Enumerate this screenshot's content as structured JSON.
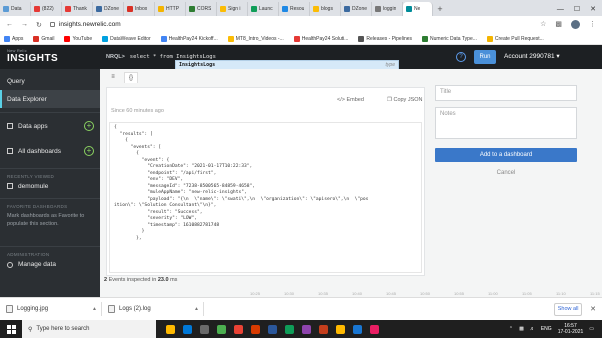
{
  "browser": {
    "tabs": [
      {
        "label": "Data",
        "color": "#5b9bd5"
      },
      {
        "label": "(822)",
        "color": "#e53935"
      },
      {
        "label": "Thank",
        "color": "#e53935"
      },
      {
        "label": "DZone",
        "color": "#3b6aa0"
      },
      {
        "label": "Inbox",
        "color": "#d93025"
      },
      {
        "label": "HTTP",
        "color": "#f4b400"
      },
      {
        "label": "CORS",
        "color": "#2e7d32"
      },
      {
        "label": "Sign i",
        "color": "#fbbc05"
      },
      {
        "label": "Launc",
        "color": "#0f9d58"
      },
      {
        "label": "Resou",
        "color": "#1e88e5"
      },
      {
        "label": "blogs",
        "color": "#fbbc05"
      },
      {
        "label": "DZone",
        "color": "#3b6aa0"
      },
      {
        "label": "loggin",
        "color": "#777777"
      },
      {
        "label": "Ne",
        "color": "#008c99"
      }
    ],
    "url": "insights.newrelic.com",
    "bookmarks": [
      {
        "label": "Apps",
        "color": "#4285f4"
      },
      {
        "label": "Gmail",
        "color": "#d93025"
      },
      {
        "label": "YouTube",
        "color": "#ff0000"
      },
      {
        "label": "DataWeave Editor",
        "color": "#00a1e0"
      },
      {
        "label": "HealthPay24 Kickoff...",
        "color": "#4285f4"
      },
      {
        "label": "MT8_Intro_Videos -...",
        "color": "#fbbc05"
      },
      {
        "label": "HealthPay24 Soluti...",
        "color": "#e53935"
      },
      {
        "label": "Releases - Pipelines",
        "color": "#555555"
      },
      {
        "label": "Numeric Data Type...",
        "color": "#2e7d32"
      },
      {
        "label": "Create Pull Request...",
        "color": "#f4b400"
      }
    ]
  },
  "app": {
    "logo_small": "New Relic",
    "logo_big": "INSIGHTS",
    "nav": {
      "query": "Query",
      "data_explorer": "Data Explorer",
      "data_apps": "Data apps",
      "all_dashboards": "All dashboards",
      "recently_viewed": "RECENTLY VIEWED",
      "recent_item": "demomule",
      "favorite_section": "FAVORITE DASHBOARDS",
      "favorite_hint": "Mark dashboards as Favorite to populate this section.",
      "administration": "ADMINISTRATION",
      "manage_data": "Manage data"
    },
    "header": {
      "nrql_label": "NRQL>",
      "query": "select * from InsightsLogs",
      "help": "?",
      "run": "Run",
      "account": "Account 2990781"
    },
    "autocomplete": {
      "name": "InsightsLogs",
      "kind": "type"
    },
    "view_tabs": [
      "≡",
      "{}"
    ],
    "results": {
      "since": "Since 60 minutes ago",
      "embed": "Embed",
      "copy_json": "Copy JSON",
      "json_text": "{\n  \"results\": [\n    {\n      \"events\": [\n        {\n          \"event\": {\n            \"CreationDate\": \"2021-01-17T10:22:33\",\n            \"endpoint\": \"/api/first\",\n            \"env\": \"DEV\",\n            \"messageId\": \"7238-8500565-84859-4658\",\n            \"muleAppName\": \"new-relic-insights\",\n            \"payload\": \"{\\n  \\\"name\\\": \\\"swati\\\",\\n  \\\"organization\\\": \\\"apisero\\\",\\n  \\\"pos\nition\\\": \\\"Solution Consultant\\\"\\n}\",\n            \"result\": \"Success\",\n            \"severity\": \"LOW\",\n            \"timestamp\": 1610882781748\n          }\n        },",
      "events_count": "2",
      "events_mid": "Events inspected in",
      "events_time": "23.0",
      "events_unit": "ms"
    },
    "form": {
      "title_placeholder": "Title",
      "notes_placeholder": "Notes",
      "add_button": "Add to a dashboard",
      "cancel": "Cancel"
    },
    "timeline": [
      "10:25",
      "10:30",
      "10:35",
      "10:40",
      "10:45",
      "10:50",
      "10:55",
      "11:00",
      "11:05",
      "11:10",
      "11:15"
    ]
  },
  "downloads": {
    "items": [
      "Logging.jpg",
      "Logs (2).log"
    ],
    "show_all": "Show all"
  },
  "taskbar": {
    "search": "Type here to search",
    "lang": "ENG",
    "time": "16:57",
    "date": "17-01-2021",
    "apps": [
      "#ffb900",
      "#0078d7",
      "#6a6a6a",
      "#4caf50",
      "#ea4335",
      "#d83b01",
      "#2b579a",
      "#0f9d58",
      "#8e44ad",
      "#c43e1c",
      "#ffb900",
      "#1976d2",
      "#e91e63"
    ]
  }
}
